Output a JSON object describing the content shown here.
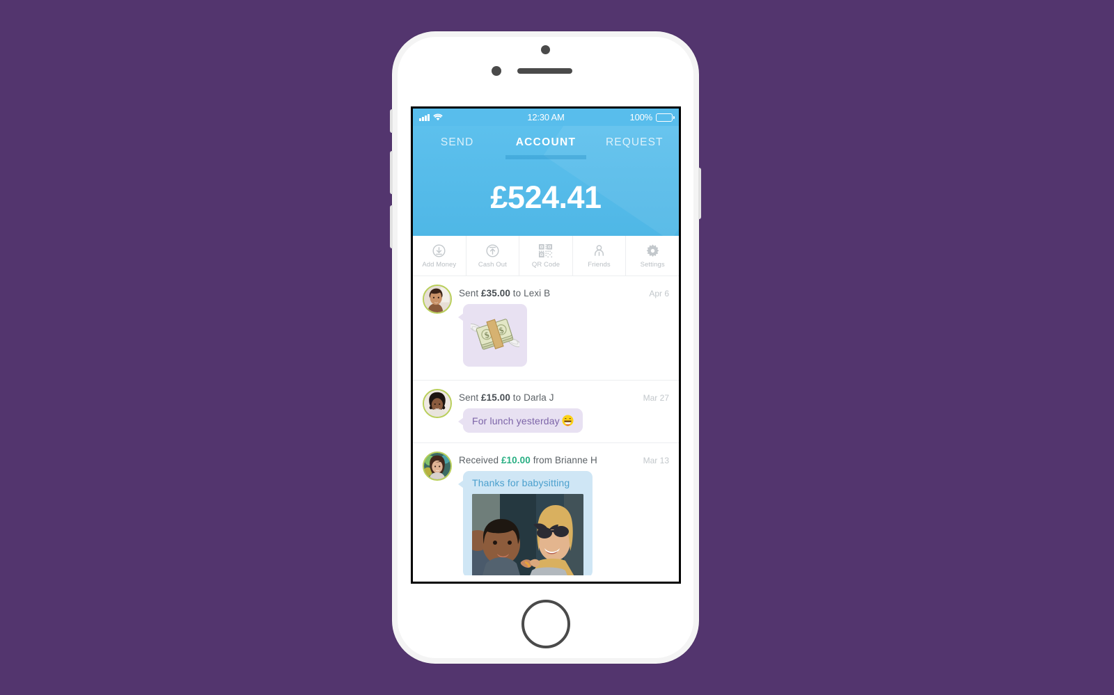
{
  "theme": {
    "page_background": "#53356e",
    "accent_blue": "#58bdec",
    "received_green": "#27ae82",
    "bubble_purple_bg": "#e8e1f2",
    "bubble_purple_text": "#7c64a8",
    "bubble_blue_bg": "#cfe6f5",
    "bubble_blue_text": "#4a9fcd",
    "avatar_ring": "#b9cf5a"
  },
  "status_bar": {
    "signal_icon": "signal-bars-icon",
    "wifi_icon": "wifi-icon",
    "time": "12:30 AM",
    "battery_percent": "100%",
    "battery_icon": "battery-full-icon"
  },
  "tabs": [
    {
      "label": "SEND",
      "active": false
    },
    {
      "label": "ACCOUNT",
      "active": true
    },
    {
      "label": "REQUEST",
      "active": false
    }
  ],
  "balance": {
    "amount": "£524.41"
  },
  "actions": [
    {
      "label": "Add Money",
      "icon": "download-arrow-icon"
    },
    {
      "label": "Cash Out",
      "icon": "upload-arrow-icon"
    },
    {
      "label": "QR Code",
      "icon": "qr-code-icon"
    },
    {
      "label": "Friends",
      "icon": "person-icon"
    },
    {
      "label": "Settings",
      "icon": "gear-icon"
    }
  ],
  "transactions": [
    {
      "direction": "sent",
      "prefix": "Sent ",
      "amount": "£35.00",
      "suffix": " to Lexi B",
      "date": "Apr 6",
      "avatar": "avatar-lexi-b",
      "bubble_type": "emoji",
      "bubble_style": "purple",
      "bubble_emoji": "money-with-wings-emoji"
    },
    {
      "direction": "sent",
      "prefix": "Sent ",
      "amount": "£15.00",
      "suffix": " to Darla J",
      "date": "Mar 27",
      "avatar": "avatar-darla-j",
      "bubble_type": "text",
      "bubble_style": "purple",
      "bubble_text": "For lunch yesterday",
      "bubble_emoji": "grinning-face-emoji"
    },
    {
      "direction": "received",
      "prefix": "Received ",
      "amount": "£10.00",
      "suffix": " from Brianne H",
      "date": "Mar 13",
      "avatar": "avatar-brianne-h",
      "bubble_type": "photo",
      "bubble_style": "blue",
      "bubble_text": "Thanks for babysitting",
      "photo": "photo-woman-and-toddler"
    }
  ]
}
